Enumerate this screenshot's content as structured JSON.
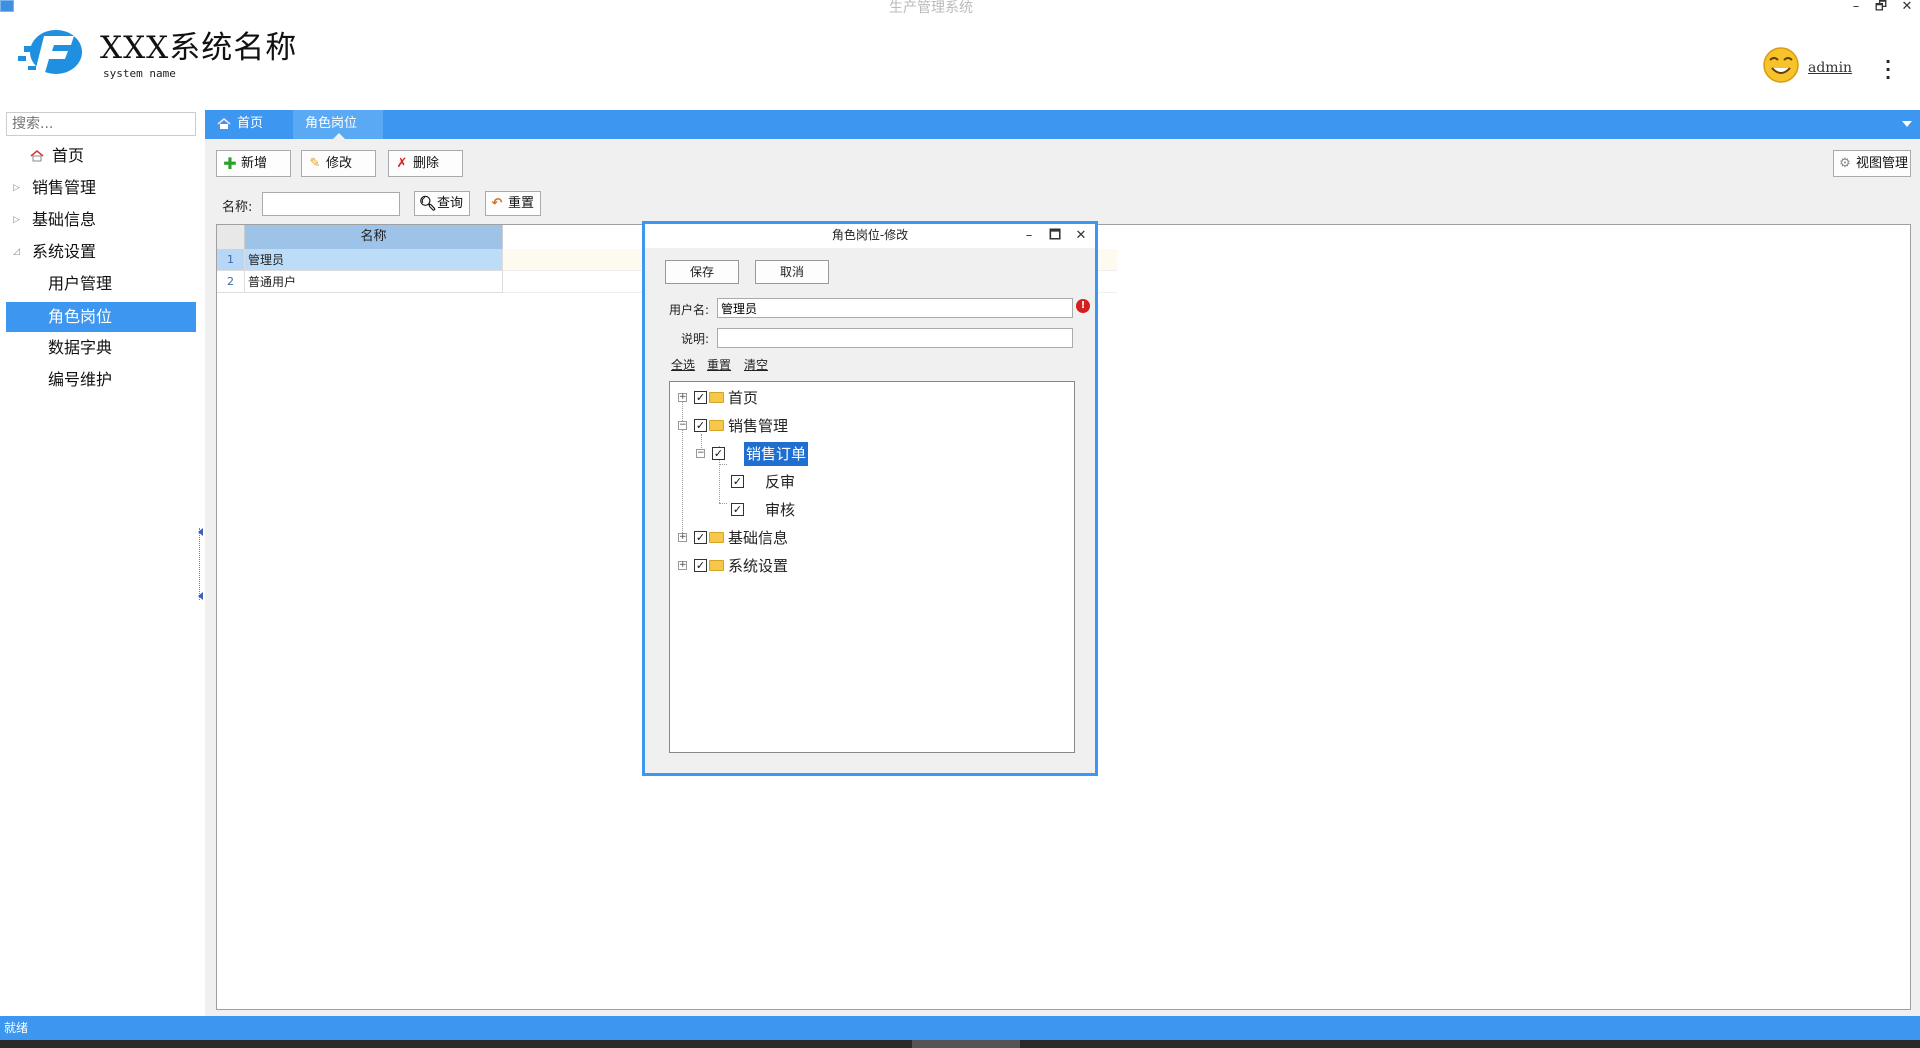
{
  "window": {
    "title": "生产管理系统",
    "controls": [
      "–",
      "🗗",
      "✕"
    ]
  },
  "header": {
    "system_name": "XXX系统名称",
    "system_sub": "system name",
    "user": "admin"
  },
  "sidebar": {
    "search_placeholder": "搜索...",
    "items": [
      {
        "label": "首页",
        "level": 0,
        "icon": "home-icon"
      },
      {
        "label": "销售管理",
        "level": 0,
        "expanded": false
      },
      {
        "label": "基础信息",
        "level": 0,
        "expanded": false
      },
      {
        "label": "系统设置",
        "level": 0,
        "expanded": true
      },
      {
        "label": "用户管理",
        "level": 1
      },
      {
        "label": "角色岗位",
        "level": 1,
        "active": true
      },
      {
        "label": "数据字典",
        "level": 1
      },
      {
        "label": "编号维护",
        "level": 1
      }
    ]
  },
  "tabs": [
    {
      "label": "首页",
      "icon": "home-icon"
    },
    {
      "label": "角色岗位",
      "selected": true
    }
  ],
  "toolbar": {
    "add": "新增",
    "edit": "修改",
    "delete": "删除",
    "view_manage": "视图管理"
  },
  "filter": {
    "label": "名称:",
    "value": "",
    "query": "查询",
    "reset": "重置"
  },
  "grid": {
    "columns": [
      "名称"
    ],
    "rows": [
      {
        "num": "1",
        "name": "管理员",
        "selected": true
      },
      {
        "num": "2",
        "name": "普通用户"
      }
    ]
  },
  "dialog": {
    "title": "角色岗位-修改",
    "save": "保存",
    "cancel": "取消",
    "username_label": "用户名:",
    "username_value": "管理员",
    "desc_label": "说明:",
    "desc_value": "",
    "links": {
      "select_all": "全选",
      "reset": "重置",
      "clear": "清空"
    },
    "tree": [
      {
        "label": "首页",
        "checked": true,
        "expander": "plus"
      },
      {
        "label": "销售管理",
        "checked": true,
        "expander": "minus"
      },
      {
        "label": "销售订单",
        "checked": true,
        "expander": "minus",
        "highlighted": true
      },
      {
        "label": "反审",
        "checked": true
      },
      {
        "label": "审核",
        "checked": true
      },
      {
        "label": "基础信息",
        "checked": true,
        "expander": "plus"
      },
      {
        "label": "系统设置",
        "checked": true,
        "expander": "plus"
      }
    ]
  },
  "status": {
    "text": "就绪"
  },
  "colors": {
    "accent": "#3d97f0",
    "selection": "#1e6fd0",
    "error": "#d62020"
  }
}
